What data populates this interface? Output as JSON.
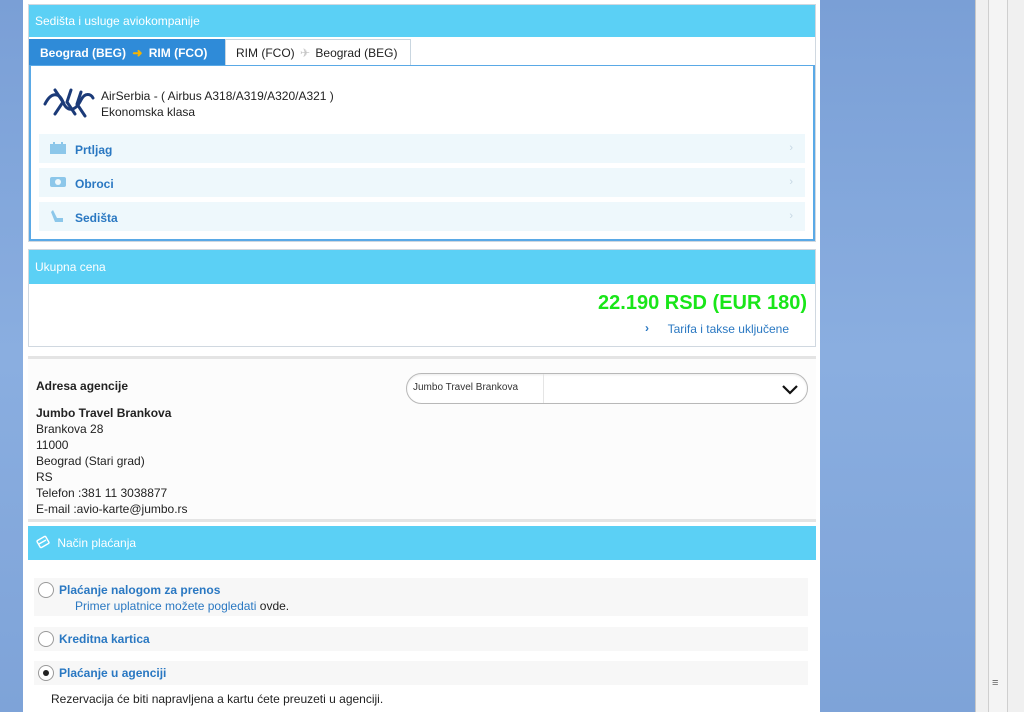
{
  "seats_panel": {
    "header": "Sedišta i usluge aviokompanije",
    "tabs": [
      {
        "from": "Beograd (BEG)",
        "to": "RIM (FCO)",
        "active": true
      },
      {
        "from": "RIM (FCO)",
        "to": "Beograd (BEG)",
        "active": false
      }
    ],
    "airline": {
      "name_line": "AirSerbia - ( Airbus  A318/A319/A320/A321 )",
      "class": "Ekonomska klasa",
      "logo_icon": "airserbia-logo"
    },
    "features": [
      {
        "label": "Prtljag",
        "icon": "luggage-icon"
      },
      {
        "label": "Obroci",
        "icon": "meal-icon"
      },
      {
        "label": "Sedišta",
        "icon": "seat-icon"
      }
    ]
  },
  "total_panel": {
    "header": "Ukupna cena",
    "price": "22.190 RSD (EUR 180)",
    "taxes_link": "Tarifa i takse uključene",
    "price_color": "#19e619"
  },
  "agency": {
    "title": "Adresa agencije",
    "select_value": "Jumbo Travel Brankova",
    "address": {
      "name": "Jumbo Travel Brankova",
      "street": "Brankova 28",
      "zip": "11000",
      "city": "Beograd (Stari grad)",
      "country": "RS",
      "phone": "Telefon :381 11 3038877",
      "email": "E-mail :avio-karte@jumbo.rs"
    }
  },
  "payment": {
    "header": "Način plaćanja",
    "options": [
      {
        "label": "Plaćanje nalogom za prenos",
        "sub_link": "Primer uplatnice možete pogledati",
        "sub_link_suffix": "ovde.",
        "selected": false
      },
      {
        "label": "Kreditna kartica",
        "selected": false
      },
      {
        "label": "Plaćanje u agenciji",
        "selected": true
      }
    ],
    "note": "Rezervacija će biti napravljena a kartu ćete preuzeti u agenciji."
  },
  "colors": {
    "header_blue": "#5bd0f5",
    "tab_active": "#2f8bd8",
    "link_blue": "#2a78c2"
  }
}
